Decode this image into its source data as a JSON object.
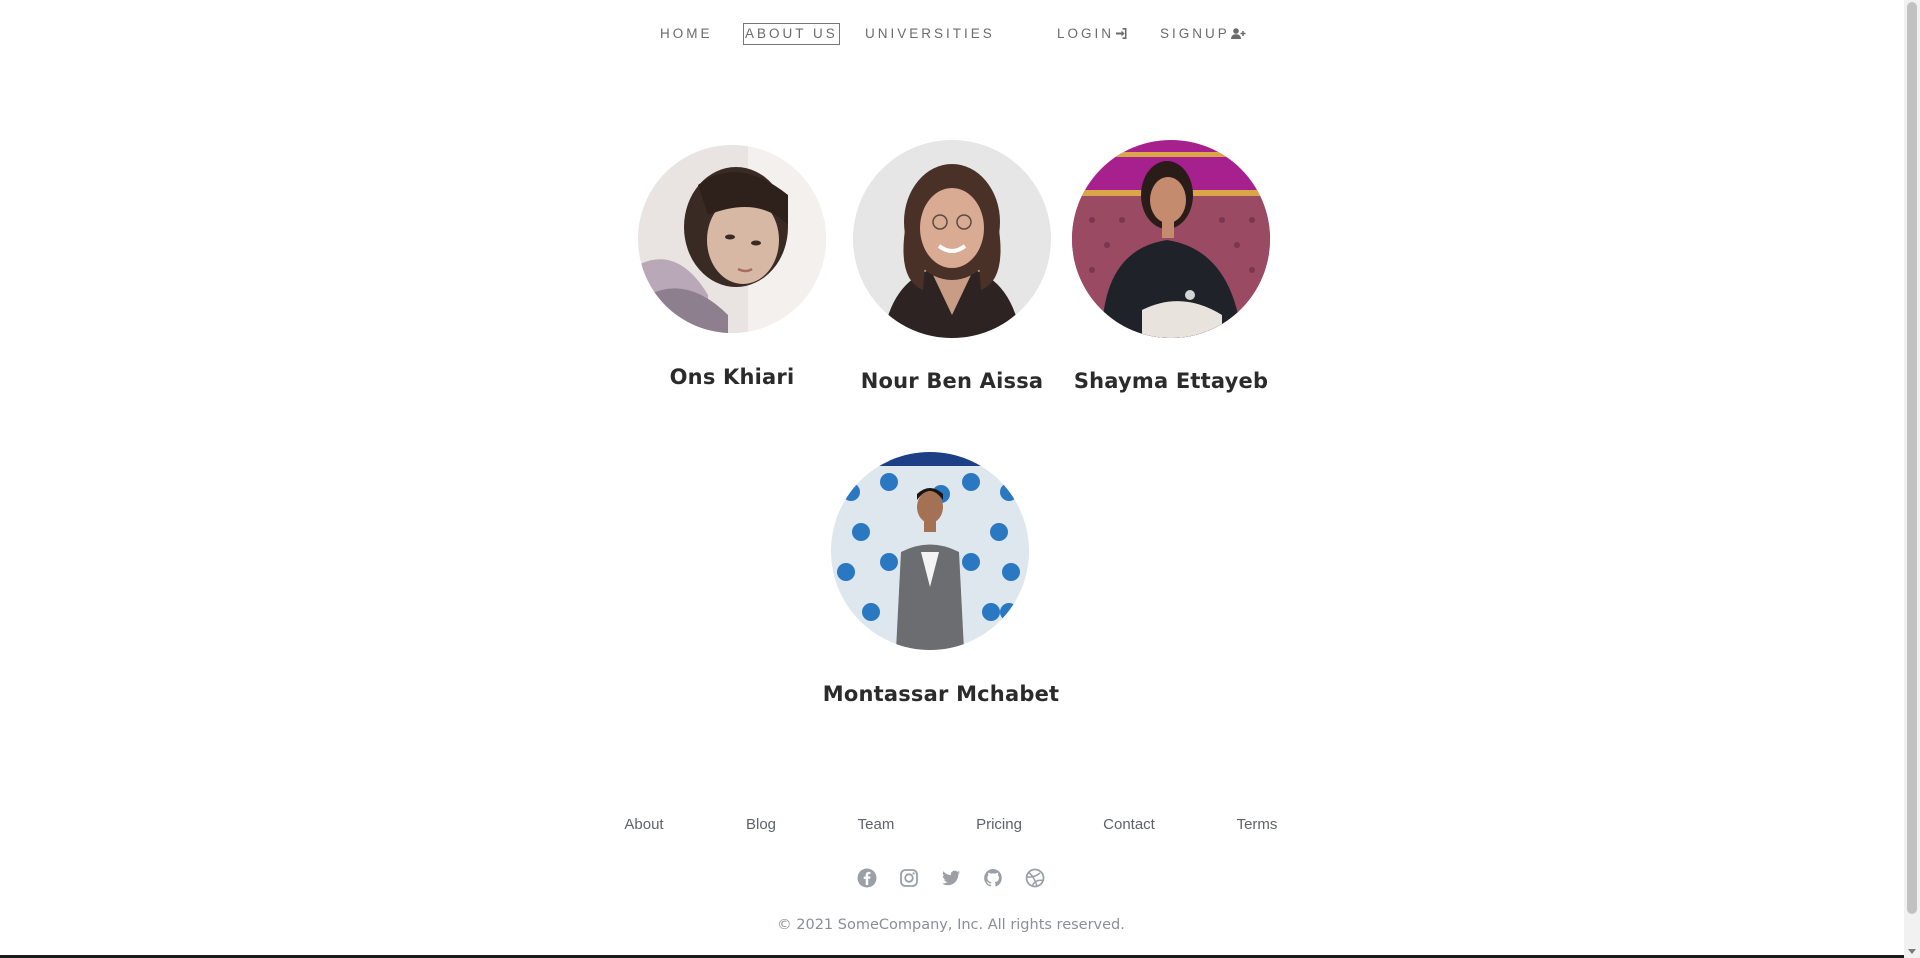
{
  "nav": {
    "items": [
      {
        "label": "HOME",
        "active": false
      },
      {
        "label": "ABOUT US",
        "active": true
      },
      {
        "label": "UNIVERSITIES",
        "active": false
      }
    ],
    "login": {
      "label": "LOGIN",
      "icon": "sign-in-icon"
    },
    "signup": {
      "label": "SIGNUP",
      "icon": "user-plus-icon"
    }
  },
  "team": [
    {
      "name": "Ons Khiari"
    },
    {
      "name": "Nour Ben Aissa"
    },
    {
      "name": "Shayma Ettayeb"
    },
    {
      "name": "Montassar Mchabet"
    }
  ],
  "footer": {
    "links": [
      "About",
      "Blog",
      "Team",
      "Pricing",
      "Contact",
      "Terms"
    ],
    "social": [
      "facebook-icon",
      "instagram-icon",
      "twitter-icon",
      "github-icon",
      "dribbble-icon"
    ],
    "copyright": "© 2021 SomeCompany, Inc. All rights reserved."
  },
  "colors": {
    "nav_text": "#6b6b6b",
    "name_text": "#2b2b2b",
    "footer_text": "#5f6368",
    "icon": "#9aa0a6"
  }
}
